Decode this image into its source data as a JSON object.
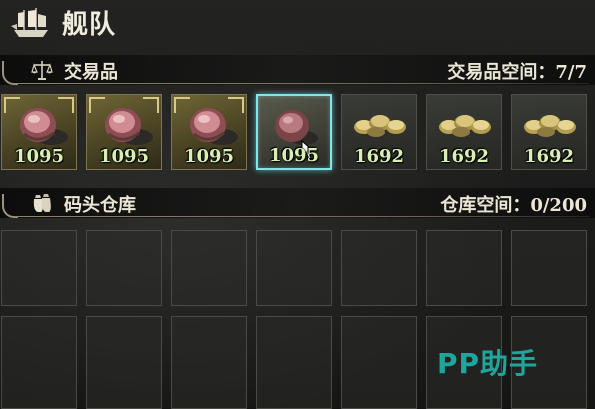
{
  "header": {
    "title": "舰队",
    "icon": "ship-icon"
  },
  "trade_section": {
    "label": "交易品",
    "icon": "scales-icon",
    "capacity_label": "交易品空间：7/7",
    "items": [
      {
        "name": "goods-meat",
        "quantity": "1095",
        "selected": false
      },
      {
        "name": "goods-meat",
        "quantity": "1095",
        "selected": false
      },
      {
        "name": "goods-meat",
        "quantity": "1095",
        "selected": false
      },
      {
        "name": "goods-meat",
        "quantity": "1095",
        "selected": true
      },
      {
        "name": "goods-coins",
        "quantity": "1692",
        "selected": false
      },
      {
        "name": "goods-coins",
        "quantity": "1692",
        "selected": false
      },
      {
        "name": "goods-coins",
        "quantity": "1692",
        "selected": false
      }
    ]
  },
  "dock_section": {
    "label": "码头仓库",
    "icon": "sacks-icon",
    "capacity_label": "仓库空间：0/200"
  },
  "watermark": "PP助手",
  "colors": {
    "selected_border": "#7fe6ea",
    "quantity_text": "#d9f0b4",
    "watermark": "#1fa69c"
  }
}
